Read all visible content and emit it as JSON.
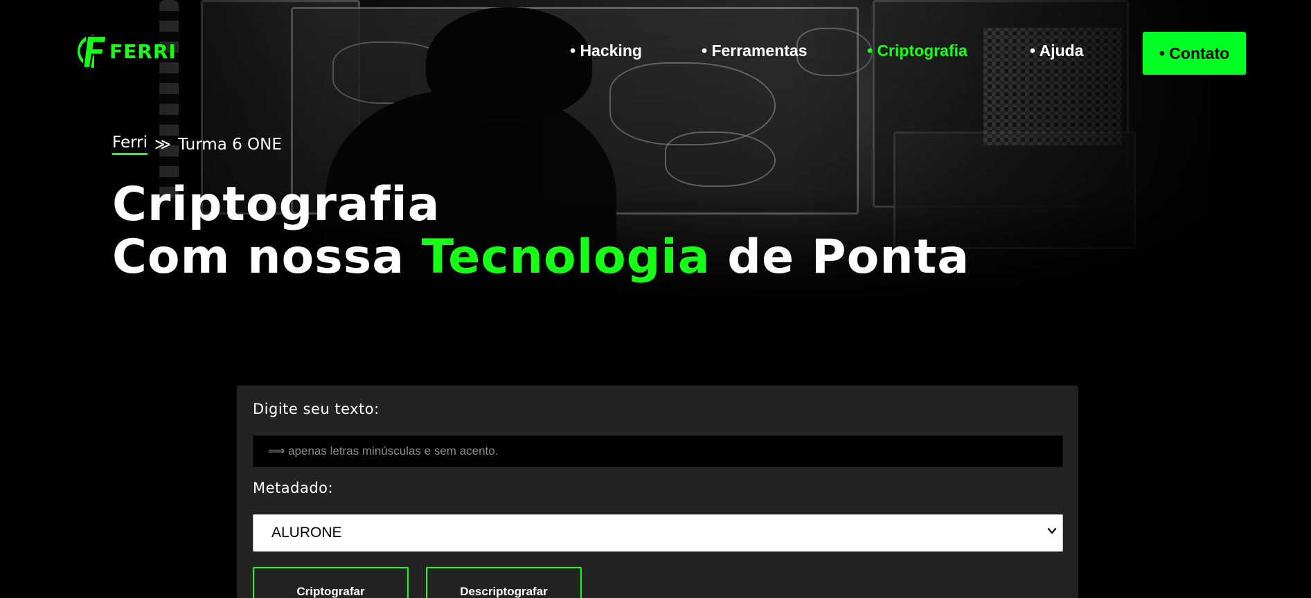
{
  "brand": {
    "logo_text": "FERRI",
    "accent_color": "#16ff16",
    "button_color": "#00ff22"
  },
  "nav": {
    "items": [
      {
        "label": "• Hacking",
        "active": false
      },
      {
        "label": "• Ferramentas",
        "active": false
      },
      {
        "label": "• Criptografia",
        "active": true
      },
      {
        "label": "• Ajuda",
        "active": false
      }
    ],
    "contact_label": "• Contato"
  },
  "breadcrumb": {
    "home": "Ferri",
    "separator": "≫",
    "current": "Turma 6 ONE"
  },
  "hero": {
    "line1": "Criptografia",
    "line2_pre": "Com nossa ",
    "line2_accent": "Tecnologia",
    "line2_post": " de Ponta"
  },
  "form": {
    "text_label": "Digite seu texto:",
    "text_placeholder": "⟹ apenas letras minúsculas e sem acento.",
    "text_value": "",
    "meta_label": "Metadado:",
    "meta_selected": "ALURONE",
    "encrypt_label": "Criptografar",
    "decrypt_label": "Descriptografar"
  },
  "icons": {
    "logo": "ferri-logo-icon",
    "select": "chevron-down-icon"
  }
}
